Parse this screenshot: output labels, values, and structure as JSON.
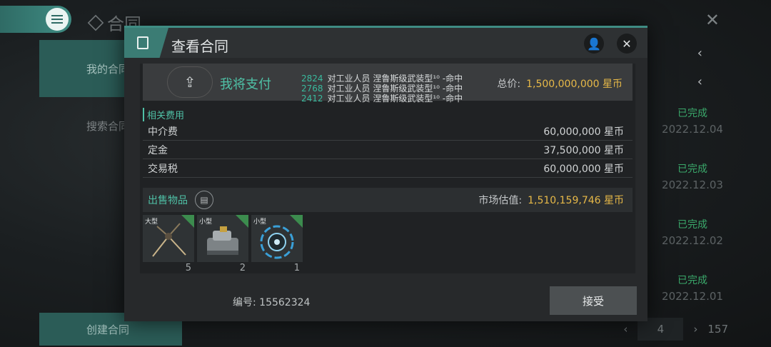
{
  "background": {
    "title": "合同",
    "sidebar": {
      "items": [
        "我的合同",
        "搜索合同"
      ],
      "create": "创建合同"
    },
    "contracts": [
      {
        "status": "已完成",
        "date": "2022.12.04"
      },
      {
        "status": "已完成",
        "date": "2022.12.03"
      },
      {
        "status": "已完成",
        "date": "2022.12.02"
      },
      {
        "status": "已完成",
        "date": "2022.12.01"
      }
    ],
    "pager": {
      "current": "4",
      "total": "157"
    }
  },
  "dialog": {
    "title": "查看合同",
    "pay": {
      "label": "我将支付",
      "items": [
        {
          "id": "2824",
          "text": "对工业人员 涅鲁斯级武装型¹⁰ -命中"
        },
        {
          "id": "2768",
          "text": "对工业人员 涅鲁斯级武装型¹⁰ -命中"
        },
        {
          "id": "2412",
          "text": "对工业人员 涅鲁斯级武装型¹⁰ -命中"
        }
      ],
      "total_label": "总价:",
      "total_value": "1,500,000,000 星币"
    },
    "fees": {
      "section": "相关费用",
      "rows": [
        {
          "name": "中介费",
          "value": "60,000,000 星币"
        },
        {
          "name": "定金",
          "value": "37,500,000 星币"
        },
        {
          "name": "交易税",
          "value": "60,000,000 星币"
        }
      ]
    },
    "sale": {
      "section": "出售物品",
      "market_label": "市场估值:",
      "market_value": "1,510,159,746 星币",
      "items": [
        {
          "size": "大型",
          "qty": "5"
        },
        {
          "size": "小型",
          "qty": "2"
        },
        {
          "size": "小型",
          "qty": "1"
        }
      ]
    },
    "contract_no": "编号: 15562324",
    "accept": "接受"
  },
  "colors": {
    "accent": "#3f8c83",
    "teal_text": "#4fc1a6",
    "gold": "#e7b948",
    "done": "#3aa86a"
  }
}
